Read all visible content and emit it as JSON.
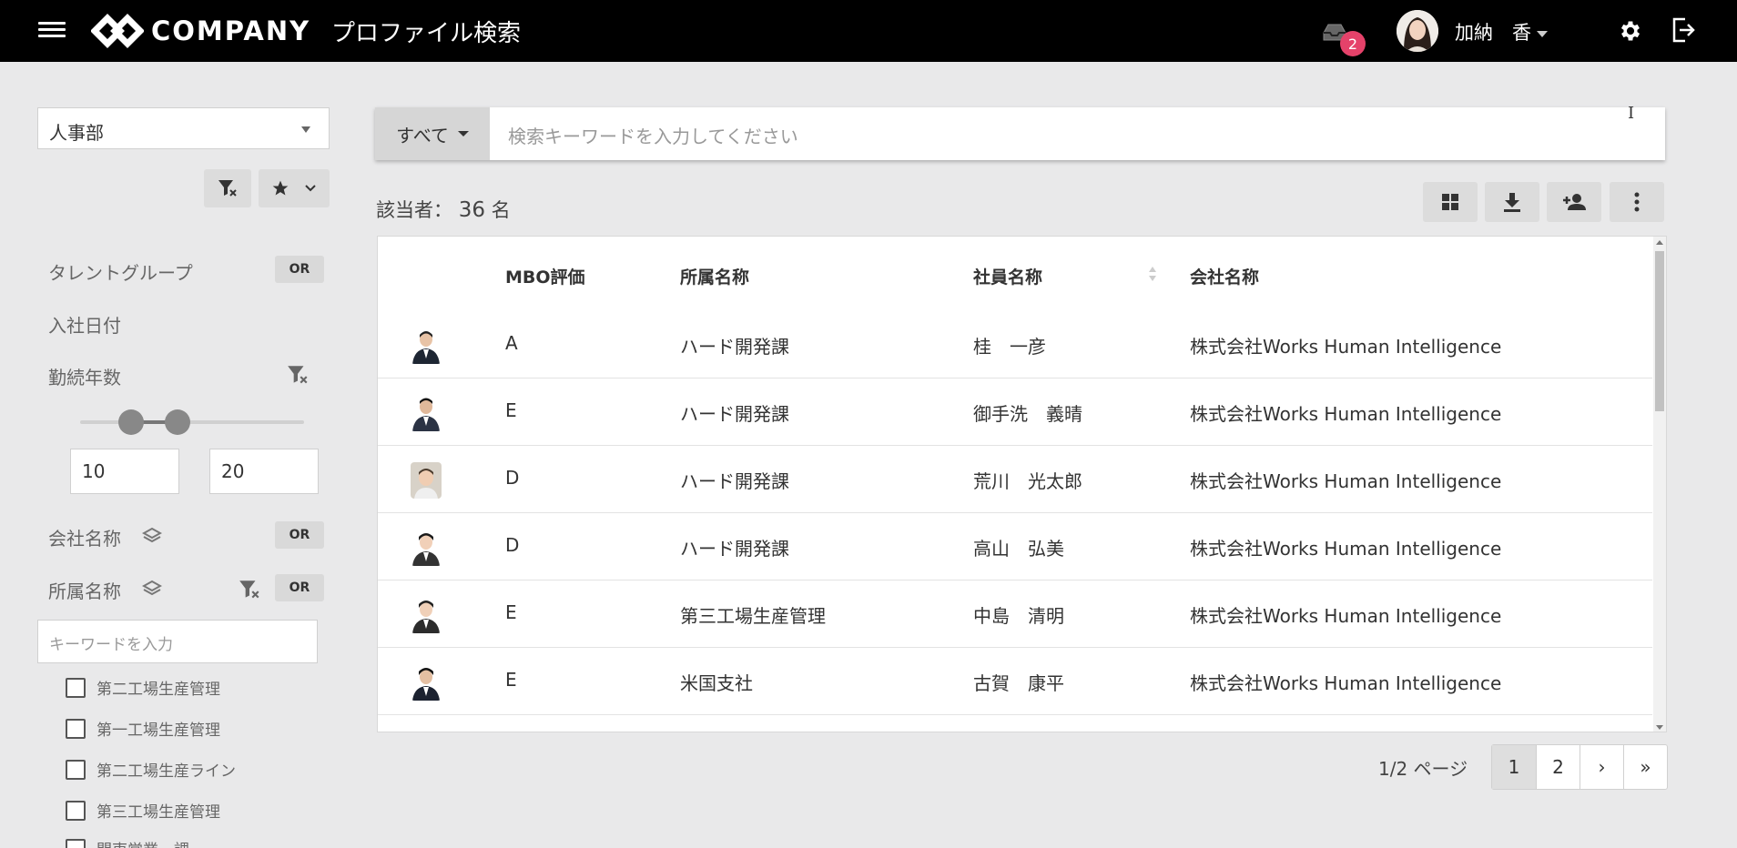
{
  "header": {
    "brand": "COMPANY",
    "title": "プロファイル検索",
    "notification_count": "2",
    "user_name": "加納　香"
  },
  "sidebar": {
    "department": "人事部",
    "filters": {
      "talent_group": "タレントグループ",
      "hire_date": "入社日付",
      "years_of_service": "勤続年数",
      "company_name": "会社名称",
      "department_name": "所属名称",
      "or_label": "OR"
    },
    "years_min": "10",
    "years_max": "20",
    "keyword_placeholder": "キーワードを入力",
    "department_options": [
      "第二工場生産管理",
      "第一工場生産管理",
      "第二工場生産ライン",
      "第三工場生産管理",
      "関東営業一課"
    ]
  },
  "search": {
    "scope": "すべて",
    "placeholder": "検索キーワードを入力してください"
  },
  "results": {
    "count_label": "該当者：",
    "count": "36",
    "count_unit": "名"
  },
  "table": {
    "columns": [
      "MBO評価",
      "所属名称",
      "社員名称",
      "会社名称"
    ],
    "rows": [
      {
        "mbo": "A",
        "dept": "ハード開発課",
        "name": "桂　一彦",
        "company": "株式会社Works Human Intelligence"
      },
      {
        "mbo": "E",
        "dept": "ハード開発課",
        "name": "御手洗　義晴",
        "company": "株式会社Works Human Intelligence"
      },
      {
        "mbo": "D",
        "dept": "ハード開発課",
        "name": "荒川　光太郎",
        "company": "株式会社Works Human Intelligence"
      },
      {
        "mbo": "D",
        "dept": "ハード開発課",
        "name": "高山　弘美",
        "company": "株式会社Works Human Intelligence"
      },
      {
        "mbo": "E",
        "dept": "第三工場生産管理",
        "name": "中島　清明",
        "company": "株式会社Works Human Intelligence"
      },
      {
        "mbo": "E",
        "dept": "米国支社",
        "name": "古賀　康平",
        "company": "株式会社Works Human Intelligence"
      }
    ]
  },
  "pagination": {
    "info": "1/2 ページ",
    "pages": [
      "1",
      "2"
    ],
    "next": "›",
    "last": "»"
  }
}
